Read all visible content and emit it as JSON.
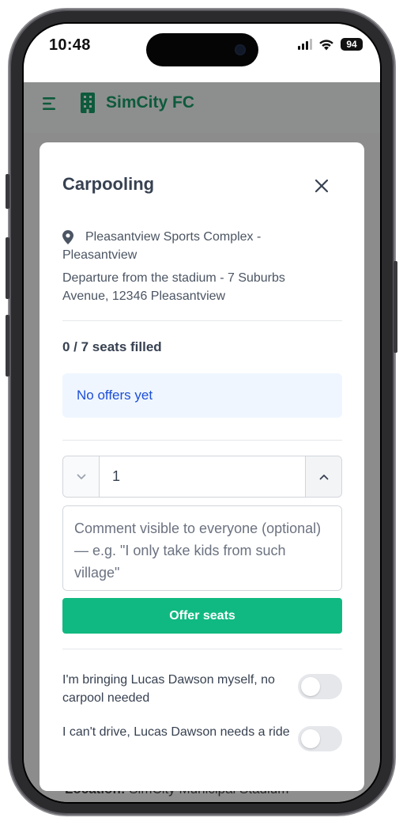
{
  "status_bar": {
    "time": "10:48",
    "battery": "94",
    "icons": [
      "signal-icon",
      "wifi-icon",
      "battery-icon"
    ]
  },
  "app_bar": {
    "title": "SimCity FC",
    "menu_icon": "menu-icon",
    "brand_icon": "building-icon"
  },
  "modal": {
    "title": "Carpooling",
    "close_icon": "close-icon",
    "location": "Pleasantview Sports Complex - Pleasantview",
    "departure": "Departure from the stadium - 7 Suburbs Avenue, 12346 Pleasantview",
    "seats_filled": "0 / 7 seats filled",
    "no_offers": "No offers yet",
    "stepper": {
      "value": "1"
    },
    "comment_placeholder": "Comment visible to everyone (optional) — e.g. \"I only take kids from such village\"",
    "offer_button": "Offer seats",
    "toggles": [
      {
        "label": "I'm bringing Lucas Dawson myself, no carpool needed",
        "checked": false
      },
      {
        "label": "I can't drive, Lucas Dawson needs a ride",
        "checked": false
      }
    ]
  },
  "background": {
    "location_label": "Location:",
    "location_value": " SimCity Municipal Stadium -"
  },
  "colors": {
    "brand": "#0d5a3c",
    "primary_button": "#10b981",
    "info_bg": "#eff6ff",
    "info_text": "#1d4ed8"
  }
}
